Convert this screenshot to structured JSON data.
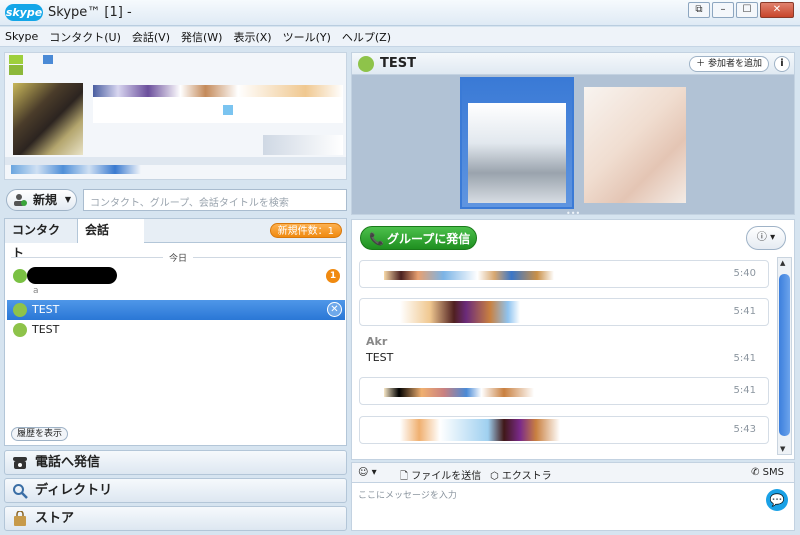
{
  "window": {
    "title": "Skype™ [1] -",
    "logo": "skype"
  },
  "menu": [
    "Skype",
    "コンタクト(U)",
    "会話(V)",
    "発信(W)",
    "表示(X)",
    "ツール(Y)",
    "ヘルプ(Z)"
  ],
  "left": {
    "new_label": "新規",
    "search_placeholder": "コンタクト、グループ、会話タイトルを検索",
    "tabs": {
      "contacts": "コンタクト",
      "conversations": "会話"
    },
    "new_badge": "新規件数：1",
    "day_label": "今日",
    "rows": [
      {
        "label": "",
        "sub": "a",
        "badge": "1",
        "status_color": "#7ac143"
      },
      {
        "label": "TEST",
        "selected": true
      },
      {
        "label": "TEST",
        "selected": false
      }
    ],
    "history_button": "履歴を表示",
    "nav": [
      {
        "label": "電話へ発信",
        "icon": "phone-icon"
      },
      {
        "label": "ディレクトリ",
        "icon": "magnifier-icon"
      },
      {
        "label": "ストア",
        "icon": "bag-icon"
      }
    ]
  },
  "conversation": {
    "title": "TEST",
    "add_participant": "参加者を追加",
    "info": "i",
    "call_button": "グループに発信",
    "messages": [
      {
        "time": "5:40"
      },
      {
        "time": "5:41"
      },
      {
        "sender": "Akr",
        "text": "TEST",
        "time": "5:41"
      },
      {
        "time": "5:41"
      },
      {
        "time": "5:43"
      }
    ],
    "toolbar": {
      "send_file": "ファイルを送信",
      "extras": "エクストラ",
      "sms": "SMS"
    },
    "input_placeholder": "ここにメッセージを入力"
  },
  "colors": {
    "accent": "#2a77d6",
    "call_green": "#1f8f20",
    "badge_orange": "#f08a10"
  }
}
